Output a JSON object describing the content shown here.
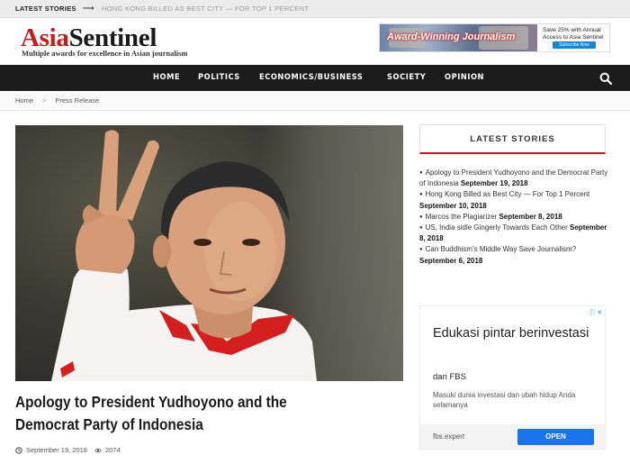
{
  "ticker": {
    "label": "LATEST STORIES",
    "headline": "HONG KONG BILLED AS BEST CITY — FOR TOP 1 PERCENT"
  },
  "logo": {
    "part1": "Asia",
    "part2": "Sentinel",
    "tagline": "Multiple awards for excellence in Asian journalism"
  },
  "banner": {
    "headline": "Award-Winning Journalism",
    "offer": "Save 25% with Annual Access to Asia Sentinel",
    "button": "Subscribe Now"
  },
  "nav": {
    "items": [
      "HOME",
      "POLITICS",
      "ECONOMICS/BUSINESS",
      "SOCIETY",
      "OPINION"
    ],
    "search_icon": "search-icon"
  },
  "breadcrumb": {
    "home": "Home",
    "sep": ">",
    "current": "Press Release"
  },
  "article": {
    "title": "Apology to President Yudhoyono and the Democrat Party of Indonesia",
    "date": "September 19, 2018",
    "views": "2074"
  },
  "sidebar": {
    "heading": "LATEST STORIES",
    "items": [
      {
        "title": "Apology to President Yudhoyono and the Democrat Party of Indonesia",
        "date": "September 19, 2018"
      },
      {
        "title": "Hong Kong Billed as Best City — For Top 1 Percent",
        "date": "September 10, 2018"
      },
      {
        "title": "Marcos the Plagiarizer",
        "date": "September 8, 2018"
      },
      {
        "title": "US, India sidle Gingerly Towards Each Other",
        "date": "September 8, 2018"
      },
      {
        "title": "Can Buddhism's Middle Way Save Journalism?",
        "date": "September 6, 2018"
      }
    ]
  },
  "ad": {
    "headline": "Edukasi pintar berinvestasi",
    "from": "dari FBS",
    "desc": "Masuki dunia investasi dan ubah hidup Anda selamanya",
    "domain": "fbs.expert",
    "button": "OPEN"
  },
  "colors": {
    "brand_red": "#c81a1a",
    "nav_bg": "#1b1b1b",
    "ad_button": "#1a73e8"
  }
}
